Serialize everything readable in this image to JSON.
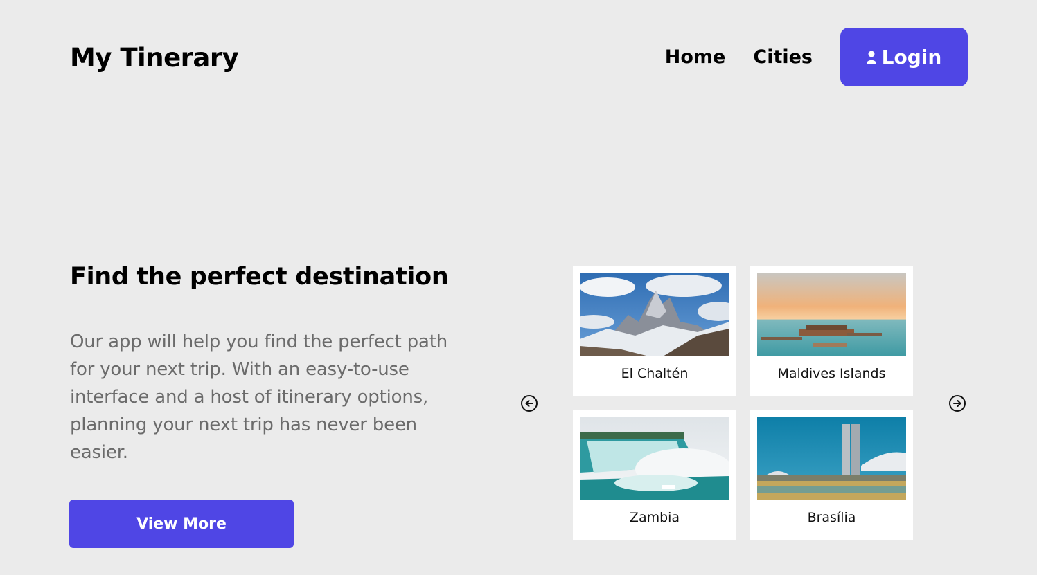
{
  "header": {
    "brand": "My Tinerary",
    "nav": {
      "home": "Home",
      "cities": "Cities"
    },
    "login_label": "Login"
  },
  "hero": {
    "title": "Find the perfect destination",
    "text": "Our app will help you find the perfect path for your next trip. With an easy-to-use interface and a host of itinerary options, planning your next trip has never been easier.",
    "cta_label": "View More"
  },
  "carousel": {
    "prev_icon": "arrow-left-circle-icon",
    "next_icon": "arrow-right-circle-icon",
    "cities": [
      {
        "name": "El Chaltén"
      },
      {
        "name": "Maldives Islands"
      },
      {
        "name": "Zambia"
      },
      {
        "name": "Brasília"
      }
    ]
  },
  "colors": {
    "accent": "#4f46e5",
    "background": "#ebebeb",
    "muted_text": "#6b6b6b"
  }
}
